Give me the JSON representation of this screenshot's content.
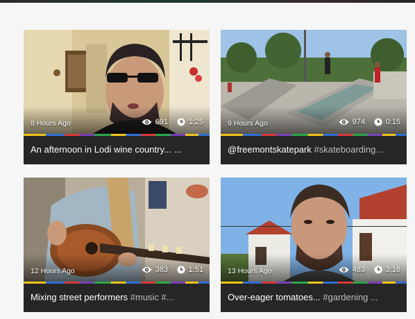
{
  "cards": [
    {
      "age": "8 Hours Ago",
      "views": "691",
      "duration": "1:25",
      "title": "An afternoon in Lodi wine country... ...",
      "tags": ""
    },
    {
      "age": "9 Hours Ago",
      "views": "974",
      "duration": "0:15",
      "title": "@freemontskatepark ",
      "tags": "#skateboarding..."
    },
    {
      "age": "12 Hours Ago",
      "views": "383",
      "duration": "1:51",
      "title": "Mixing street performers ",
      "tags": "#music #..."
    },
    {
      "age": "13 Hours Ago",
      "views": "483",
      "duration": "3:16",
      "title": "Over-eager tomatoes... ",
      "tags": "#gardening ..."
    }
  ],
  "icons": {
    "views": "eye-icon",
    "duration": "clock-icon"
  }
}
